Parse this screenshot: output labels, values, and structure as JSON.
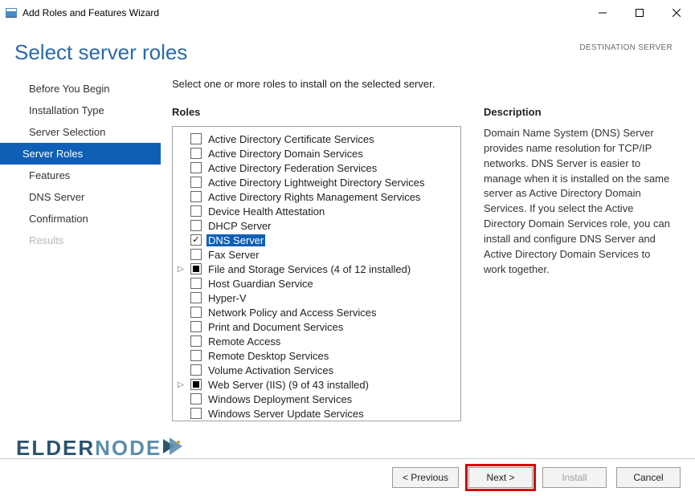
{
  "window": {
    "title": "Add Roles and Features Wizard"
  },
  "header": {
    "page_title": "Select server roles",
    "destination_label": "DESTINATION SERVER"
  },
  "nav": {
    "items": [
      {
        "label": "Before You Begin",
        "state": "normal"
      },
      {
        "label": "Installation Type",
        "state": "normal"
      },
      {
        "label": "Server Selection",
        "state": "normal"
      },
      {
        "label": "Server Roles",
        "state": "active"
      },
      {
        "label": "Features",
        "state": "normal"
      },
      {
        "label": "DNS Server",
        "state": "normal"
      },
      {
        "label": "Confirmation",
        "state": "normal"
      },
      {
        "label": "Results",
        "state": "disabled"
      }
    ]
  },
  "content": {
    "instruction": "Select one or more roles to install on the selected server.",
    "roles_heading": "Roles",
    "roles": [
      {
        "label": "Active Directory Certificate Services",
        "check": "unchecked",
        "expandable": false,
        "selected": false
      },
      {
        "label": "Active Directory Domain Services",
        "check": "unchecked",
        "expandable": false,
        "selected": false
      },
      {
        "label": "Active Directory Federation Services",
        "check": "unchecked",
        "expandable": false,
        "selected": false
      },
      {
        "label": "Active Directory Lightweight Directory Services",
        "check": "unchecked",
        "expandable": false,
        "selected": false
      },
      {
        "label": "Active Directory Rights Management Services",
        "check": "unchecked",
        "expandable": false,
        "selected": false
      },
      {
        "label": "Device Health Attestation",
        "check": "unchecked",
        "expandable": false,
        "selected": false
      },
      {
        "label": "DHCP Server",
        "check": "unchecked",
        "expandable": false,
        "selected": false
      },
      {
        "label": "DNS Server",
        "check": "checked",
        "expandable": false,
        "selected": true
      },
      {
        "label": "Fax Server",
        "check": "unchecked",
        "expandable": false,
        "selected": false
      },
      {
        "label": "File and Storage Services (4 of 12 installed)",
        "check": "partial",
        "expandable": true,
        "selected": false
      },
      {
        "label": "Host Guardian Service",
        "check": "unchecked",
        "expandable": false,
        "selected": false
      },
      {
        "label": "Hyper-V",
        "check": "unchecked",
        "expandable": false,
        "selected": false
      },
      {
        "label": "Network Policy and Access Services",
        "check": "unchecked",
        "expandable": false,
        "selected": false
      },
      {
        "label": "Print and Document Services",
        "check": "unchecked",
        "expandable": false,
        "selected": false
      },
      {
        "label": "Remote Access",
        "check": "unchecked",
        "expandable": false,
        "selected": false
      },
      {
        "label": "Remote Desktop Services",
        "check": "unchecked",
        "expandable": false,
        "selected": false
      },
      {
        "label": "Volume Activation Services",
        "check": "unchecked",
        "expandable": false,
        "selected": false
      },
      {
        "label": "Web Server (IIS) (9 of 43 installed)",
        "check": "partial",
        "expandable": true,
        "selected": false
      },
      {
        "label": "Windows Deployment Services",
        "check": "unchecked",
        "expandable": false,
        "selected": false
      },
      {
        "label": "Windows Server Update Services",
        "check": "unchecked",
        "expandable": false,
        "selected": false
      }
    ],
    "description_heading": "Description",
    "description_text": "Domain Name System (DNS) Server provides name resolution for TCP/IP networks. DNS Server is easier to manage when it is installed on the same server as Active Directory Domain Services. If you select the Active Directory Domain Services role, you can install and configure DNS Server and Active Directory Domain Services to work together."
  },
  "logo": {
    "text1": "ELDER",
    "text2": "NODE"
  },
  "footer": {
    "previous": "< Previous",
    "next": "Next >",
    "install": "Install",
    "cancel": "Cancel"
  }
}
